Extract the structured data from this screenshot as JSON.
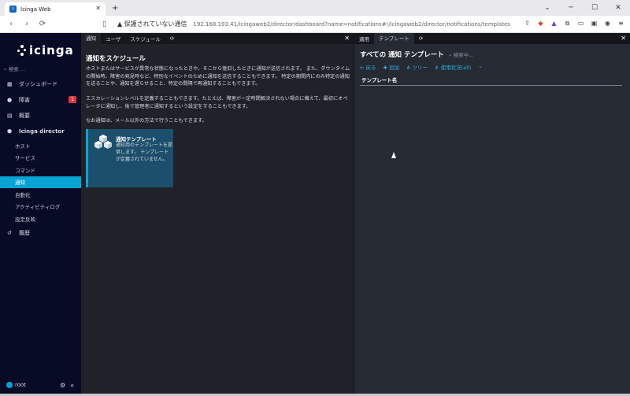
{
  "browser": {
    "tab_title": "Icinga Web",
    "security_warning": "保護されていない通信",
    "url": "192.168.193.41/icingaweb2/director/dashboard?name=notifications#!/icingaweb2/director/notifications/templates"
  },
  "sidebar": {
    "logo_text": "icinga",
    "search_placeholder": "検索 ...",
    "items": [
      {
        "label": "ダッシュボード",
        "icon": "dashboard-icon"
      },
      {
        "label": "障害",
        "icon": "warning-icon",
        "badge": "1"
      },
      {
        "label": "概要",
        "icon": "overview-icon"
      },
      {
        "label": "Icinga director",
        "icon": "director-icon"
      }
    ],
    "director_sub": [
      "ホスト",
      "サービス",
      "コマンド",
      "通知",
      "自動化",
      "アクティビティログ",
      "設定反映"
    ],
    "active_sub": "通知",
    "history": "履歴",
    "user": "root"
  },
  "left_pane": {
    "tabs": [
      "通知",
      "ユーザ",
      "スケジュール"
    ],
    "title": "通知をスケジュール",
    "p1": "ホストまたはサービスが異常な状態になったときや、そこから復旧したときに通知が送信されます。 また、ダウンタイムの開始時、障害の発見時など、特別なイベントのために通知を送信することもできます。 特定の期間内にのみ特定の通知を送ることや、通知を遅らせること、特定の間隔で再通知することもできます。",
    "p2": "エスカレーションレベルを定義することもできます。たとえば、障害が一定時間解決されない場合に備えて、最初にオペレータに通知し、後で管理者に通知するという設定をすることもできます。",
    "p3": "なお通知は、メール以外の方法で行うこともできます。",
    "tile_title": "通知テンプレート",
    "tile_desc": "通知用のテンプレートを提供します。 テンプレートが定義されていません。"
  },
  "right_pane": {
    "tabs": [
      "適用",
      "テンプレート"
    ],
    "title": "すべての 通知 テンプレート",
    "search_placeholder": "検索中...",
    "actions": [
      "戻る",
      "追加",
      "ツリー",
      "使用状況(all)"
    ],
    "column_header": "テンプレート名"
  },
  "colors": {
    "sidebar_bg": "#070b26",
    "accent": "#0aa3d6",
    "pane_bg": "#1f2229",
    "tile_bg": "#1c4f6b"
  }
}
